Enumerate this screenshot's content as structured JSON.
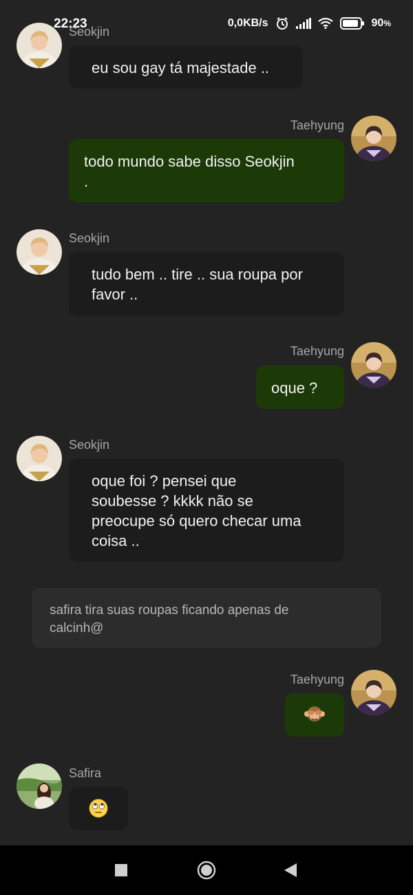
{
  "status_bar": {
    "time": "22:23",
    "net_speed": "0,0KB/s",
    "battery": "90",
    "battery_unit": "%"
  },
  "messages": [
    {
      "sender": "Seokjin",
      "side": "left",
      "text": "eu sou gay tá majestade .."
    },
    {
      "sender": "Taehyung",
      "side": "right",
      "lines": [
        "todo mundo sabe disso Seokjin",
        "."
      ]
    },
    {
      "sender": "Seokjin",
      "side": "left",
      "lines": [
        "tudo bem .. tire .. sua roupa por",
        "favor .."
      ]
    },
    {
      "sender": "Taehyung",
      "side": "right",
      "text": "oque ?"
    },
    {
      "sender": "Seokjin",
      "side": "left",
      "lines": [
        "oque foi ? pensei que",
        "soubesse ? kkkk não se",
        "preocupe só quero checar uma",
        "coisa .."
      ]
    },
    {
      "sender": "Taehyung",
      "side": "right",
      "text": "🙈",
      "emoji_name": "see-no-evil-monkey"
    },
    {
      "sender": "Safira",
      "side": "left",
      "text": "🙄",
      "emoji_name": "face-with-rolling-eyes"
    }
  ],
  "narration": {
    "lines": [
      "safira tira suas roupas ficando apenas de",
      "calcinh@"
    ]
  },
  "colors": {
    "background": "#232323",
    "left_bubble": "#1c1c1c",
    "right_bubble": "#1c3a07",
    "narration_box": "#2c2c2c",
    "name_text": "#a7a7a7",
    "nav_bar": "#000000"
  },
  "nav_bar": {
    "icons": [
      "recent-apps-icon",
      "home-icon",
      "back-icon"
    ]
  }
}
